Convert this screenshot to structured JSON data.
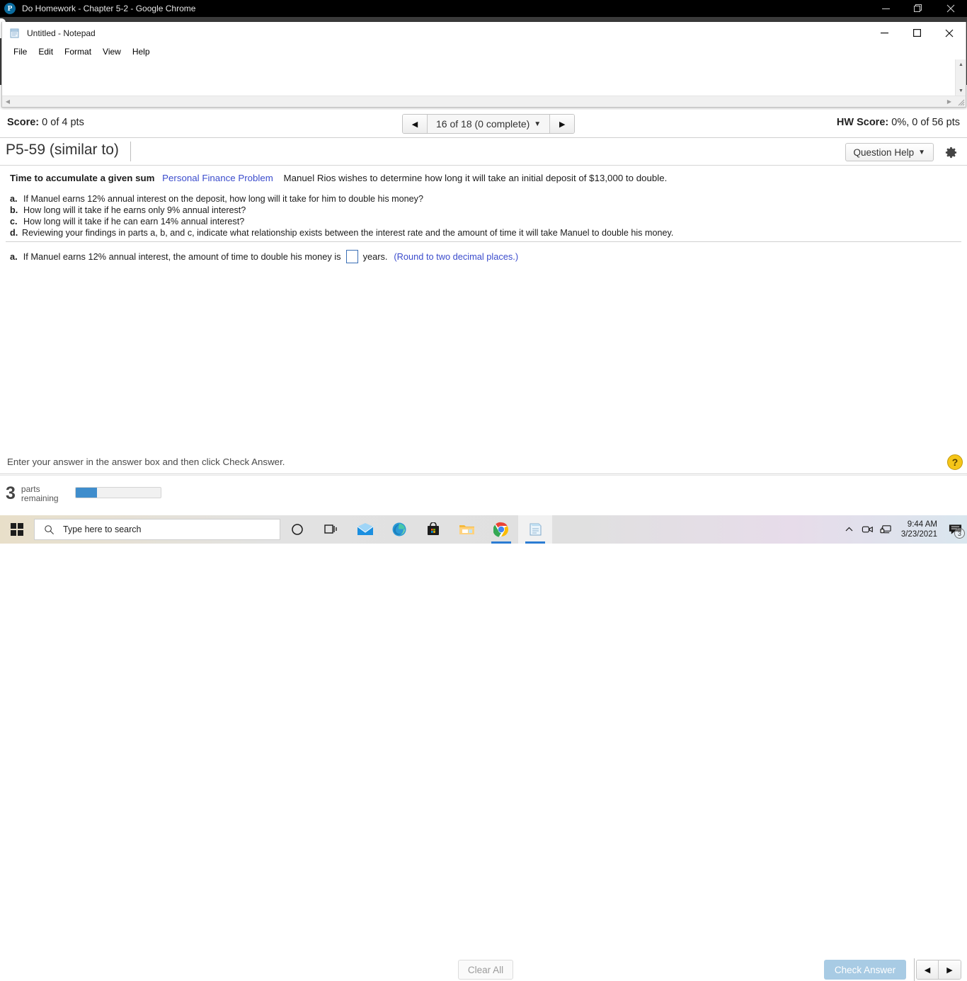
{
  "chrome_window": {
    "title": "Do Homework - Chapter 5-2 - Google Chrome",
    "favicon_letter": "P",
    "favicon_name": "pearson-favicon",
    "minimize_label": "Minimize",
    "maximize_label": "Restore",
    "close_label": "Close"
  },
  "notepad_window": {
    "title": "Untitled - Notepad",
    "menu": [
      "File",
      "Edit",
      "Format",
      "View",
      "Help"
    ],
    "text_content": "",
    "minimize_label": "Minimize",
    "maximize_label": "Maximize",
    "close_label": "Close"
  },
  "score_bar": {
    "score_label": "Score:",
    "score_value": "0 of 4 pts",
    "hw_score_label": "HW Score:",
    "hw_score_value": "0%, 0 of 56 pts"
  },
  "pager": {
    "prev_icon": "◀",
    "next_icon": "▶",
    "label": "16 of 18 (0 complete)",
    "caret": "▼"
  },
  "title_bar": {
    "exercise_title": "P5-59 (similar to)",
    "question_help_label": "Question Help",
    "question_help_caret": "▼",
    "settings_icon": "gear-icon"
  },
  "question": {
    "topic": "Time to accumulate a given sum",
    "tag": "Personal Finance Problem",
    "stem": "Manuel Rios wishes to determine how long it will take an initial deposit of $13,000 to double.",
    "parts": [
      {
        "letter": "a.",
        "text": "If Manuel earns 12% annual interest on the deposit, how long will it take for him to double his money?"
      },
      {
        "letter": "b.",
        "text": "How long will it take if he earns only 9% annual interest?"
      },
      {
        "letter": "c.",
        "text": "How long will it take if he can earn 14% annual interest?"
      },
      {
        "letter": "d.",
        "text": "Reviewing your findings in parts a, b, and c, indicate what relationship exists between the interest rate and the amount of time it will take Manuel to double his money."
      }
    ],
    "answer": {
      "letter": "a.",
      "prefix": "If Manuel earns 12% annual interest, the amount of time to double his money is",
      "input_value": "",
      "unit": "years.",
      "rounding_note": "(Round to two decimal places.)"
    }
  },
  "instruction": {
    "text": "Enter your answer in the answer box and then click Check Answer.",
    "help_glyph": "?"
  },
  "bottom_bar": {
    "parts_count": "3",
    "parts_label_line1": "parts",
    "parts_label_line2": "remaining",
    "progress_percent": 25,
    "clear_all_label": "Clear All",
    "check_answer_label": "Check Answer",
    "prev_icon": "◀",
    "next_icon": "▶"
  },
  "taskbar": {
    "start_name": "start-button",
    "search_placeholder": "Type here to search",
    "items": [
      {
        "name": "cortana-icon"
      },
      {
        "name": "task-view-icon"
      },
      {
        "name": "mail-icon"
      },
      {
        "name": "edge-icon"
      },
      {
        "name": "microsoft-store-icon"
      },
      {
        "name": "file-explorer-icon"
      },
      {
        "name": "chrome-icon"
      },
      {
        "name": "notepad-icon"
      }
    ],
    "tray": {
      "chevron": "⌃",
      "time": "9:44 AM",
      "date": "3/23/2021",
      "notification_count": "3"
    }
  },
  "colors": {
    "link_blue": "#3b4ccc",
    "progress_blue": "#3f8dcc",
    "check_answer_blue": "#a8cbe4",
    "help_yellow": "#f5c518"
  }
}
